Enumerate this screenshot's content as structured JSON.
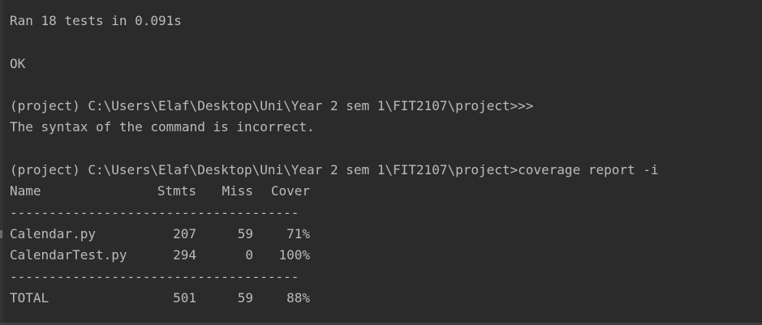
{
  "terminal": {
    "top_separator": "----------------------------------------------------------------------",
    "ran_line": "Ran 18 tests in 0.091s",
    "ok_line": "OK",
    "prompt1": "(project) C:\\Users\\Elaf\\Desktop\\Uni\\Year 2 sem 1\\FIT2107\\project>>>",
    "error_line": "The syntax of the command is incorrect.",
    "prompt2": "(project) C:\\Users\\Elaf\\Desktop\\Uni\\Year 2 sem 1\\FIT2107\\project>coverage report -i"
  },
  "coverage": {
    "headers": {
      "name": "Name",
      "stmts": "Stmts",
      "miss": "Miss",
      "cover": "Cover"
    },
    "separator": "-------------------------------------",
    "rows": [
      {
        "name": "Calendar.py",
        "stmts": "207",
        "miss": "59",
        "cover": "71%"
      },
      {
        "name": "CalendarTest.py",
        "stmts": "294",
        "miss": "0",
        "cover": "100%"
      }
    ],
    "total": {
      "name": "TOTAL",
      "stmts": "501",
      "miss": "59",
      "cover": "88%"
    }
  }
}
